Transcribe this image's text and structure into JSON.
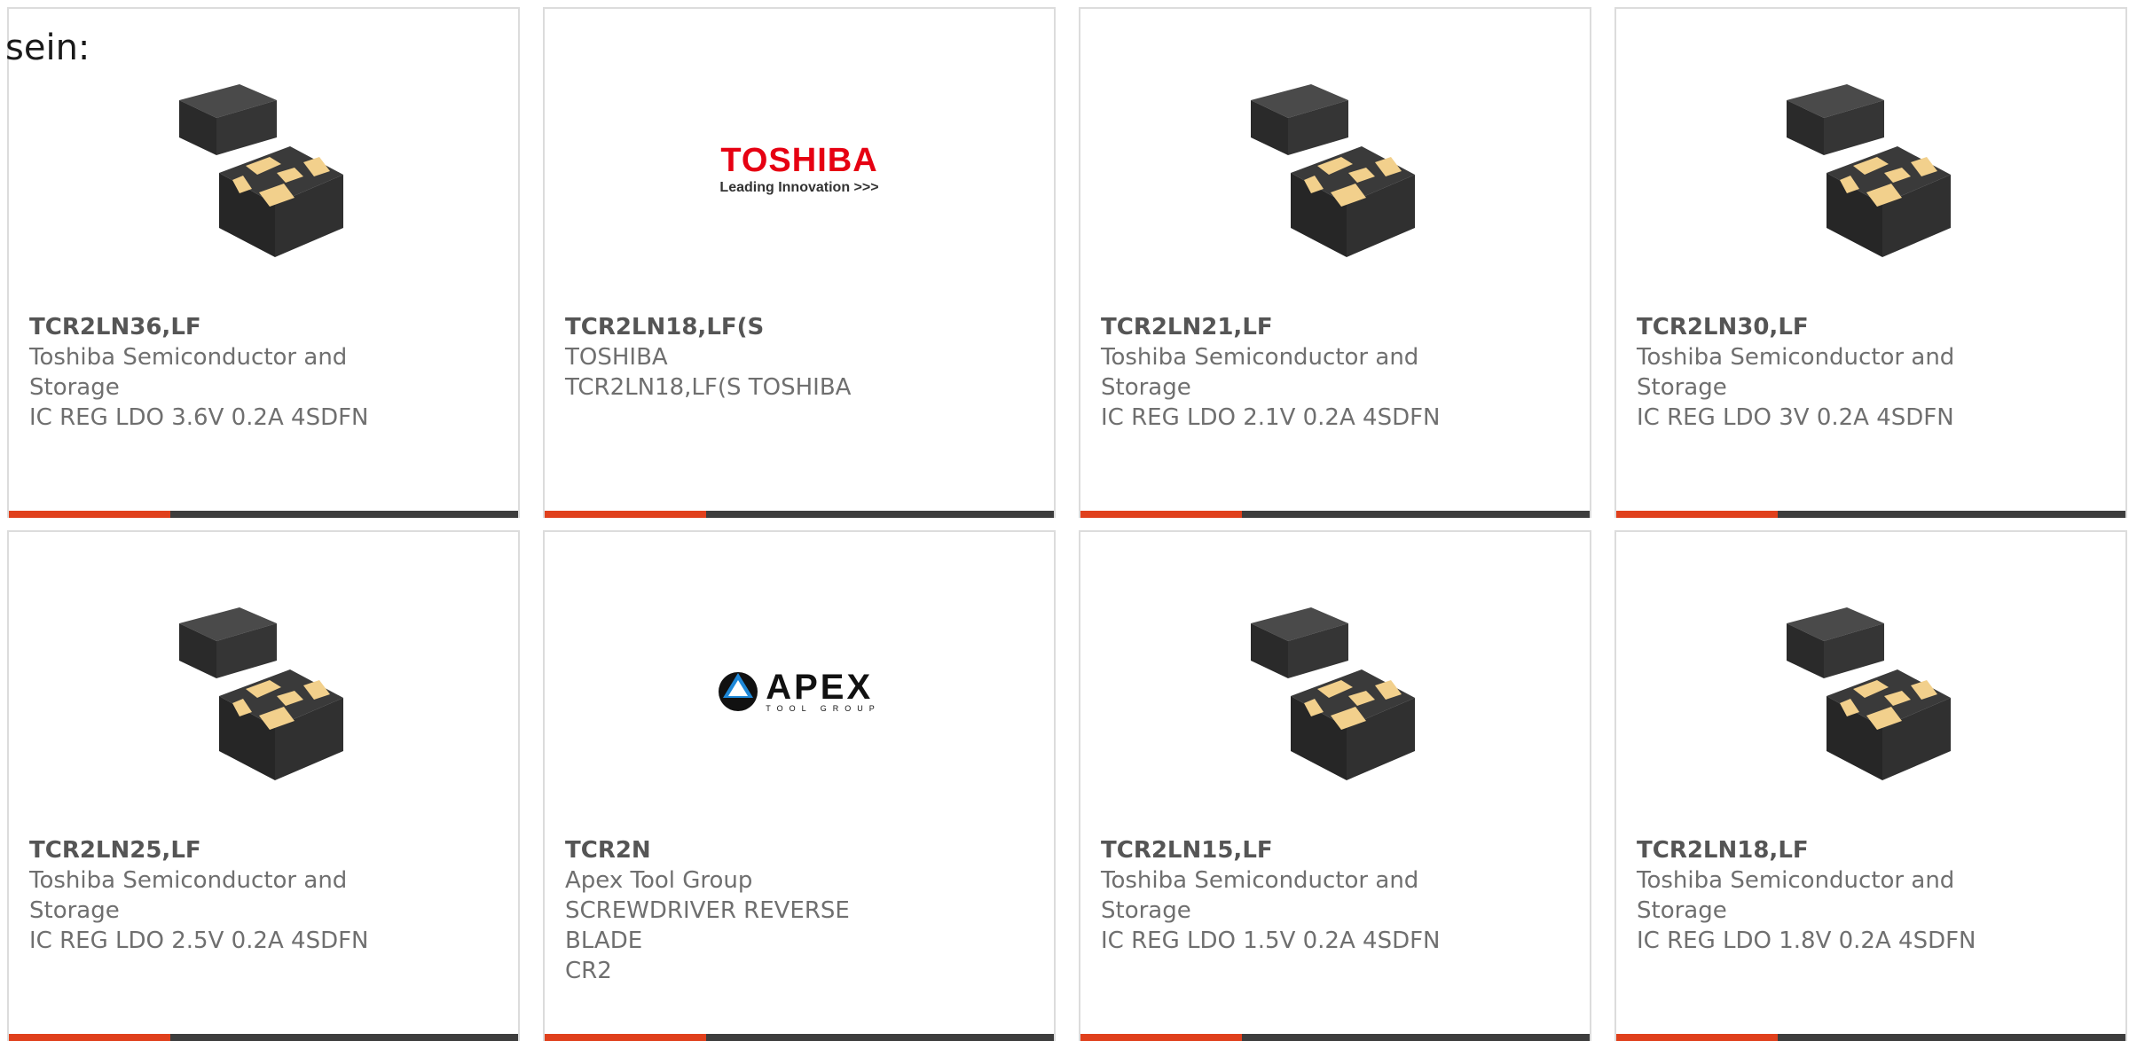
{
  "intro_text": "sein:",
  "accent_color": "#e0401c",
  "toshiba_logo": {
    "brand": "TOSHIBA",
    "tagline": "Leading Innovation >>>",
    "brand_color": "#e60012"
  },
  "apex_logo": {
    "brand": "APEX",
    "tagline": "TOOL GROUP"
  },
  "products": [
    {
      "part": "TCR2LN36,LF",
      "lines": [
        "Toshiba Semiconductor and",
        "Storage",
        "IC REG LDO 3.6V 0.2A 4SDFN"
      ],
      "image": "chip-icon"
    },
    {
      "part": "TCR2LN18,LF(S",
      "lines": [
        "TOSHIBA",
        "TCR2LN18,LF(S TOSHIBA",
        ""
      ],
      "image": "toshiba-logo"
    },
    {
      "part": "TCR2LN21,LF",
      "lines": [
        "Toshiba Semiconductor and",
        "Storage",
        "IC REG LDO 2.1V 0.2A 4SDFN"
      ],
      "image": "chip-icon"
    },
    {
      "part": "TCR2LN30,LF",
      "lines": [
        "Toshiba Semiconductor and",
        "Storage",
        "IC REG LDO 3V 0.2A 4SDFN"
      ],
      "image": "chip-icon"
    },
    {
      "part": "TCR2LN25,LF",
      "lines": [
        "Toshiba Semiconductor and",
        "Storage",
        "IC REG LDO 2.5V 0.2A 4SDFN"
      ],
      "image": "chip-icon"
    },
    {
      "part": "TCR2N",
      "lines": [
        "Apex Tool Group",
        "SCREWDRIVER REVERSE BLADE",
        "CR2"
      ],
      "image": "apex-logo"
    },
    {
      "part": "TCR2LN15,LF",
      "lines": [
        "Toshiba Semiconductor and",
        "Storage",
        "IC REG LDO 1.5V 0.2A 4SDFN"
      ],
      "image": "chip-icon"
    },
    {
      "part": "TCR2LN18,LF",
      "lines": [
        "Toshiba Semiconductor and",
        "Storage",
        "IC REG LDO 1.8V 0.2A 4SDFN"
      ],
      "image": "chip-icon"
    }
  ]
}
